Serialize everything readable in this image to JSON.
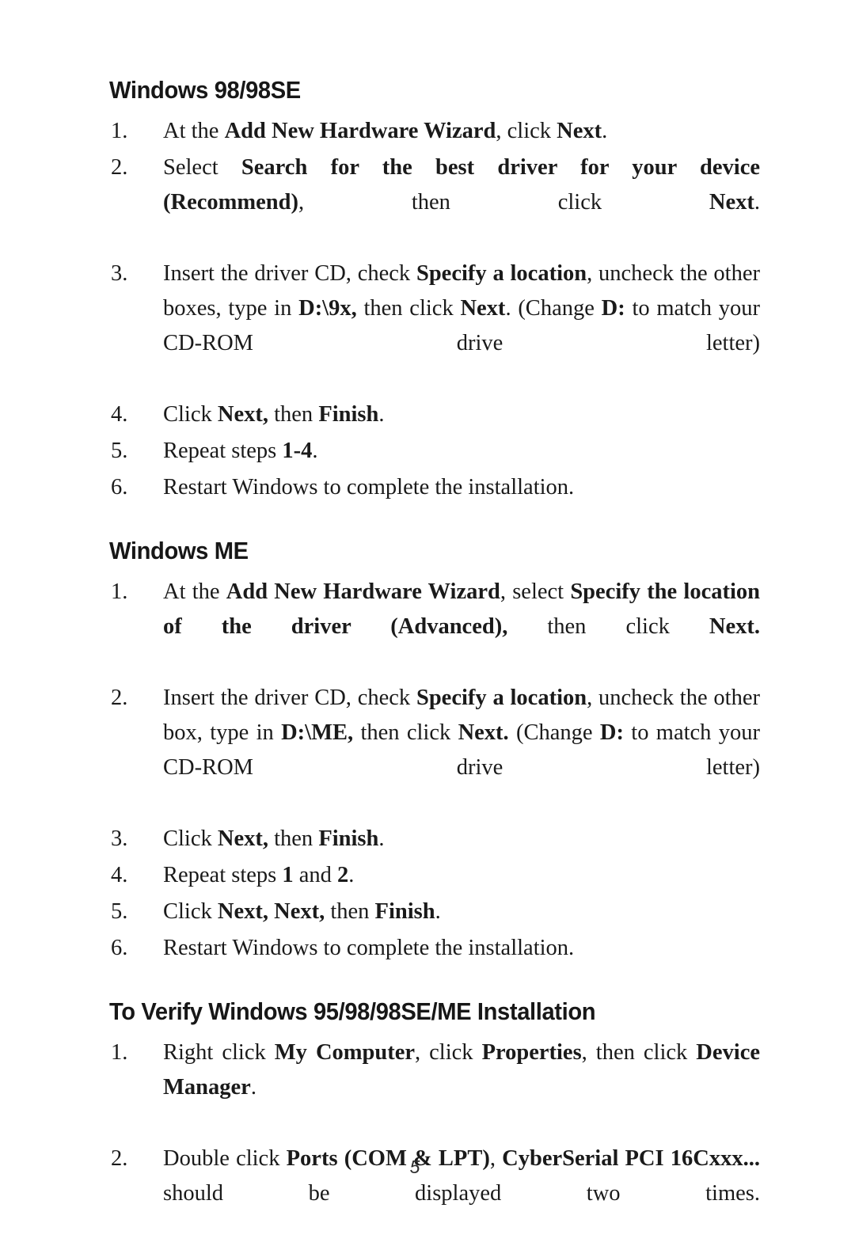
{
  "page": {
    "number": "5"
  },
  "sections": [
    {
      "heading": "Windows 98/98SE",
      "steps": [
        {
          "num": "1.",
          "parts": [
            {
              "t": "At the ",
              "b": false
            },
            {
              "t": "Add New Hardware Wizard",
              "b": true
            },
            {
              "t": ", click ",
              "b": false
            },
            {
              "t": "Next",
              "b": true
            },
            {
              "t": ".",
              "b": false
            }
          ]
        },
        {
          "num": "2.",
          "parts": [
            {
              "t": "Select ",
              "b": false
            },
            {
              "t": "Search for the best driver for your device (Recommend)",
              "b": true
            },
            {
              "t": ", then click ",
              "b": false
            },
            {
              "t": "Next",
              "b": true
            },
            {
              "t": ".",
              "b": false
            }
          ]
        },
        {
          "num": "3.",
          "parts": [
            {
              "t": "Insert the driver CD, check ",
              "b": false
            },
            {
              "t": "Specify a location",
              "b": true
            },
            {
              "t": ", uncheck the other boxes,  type in ",
              "b": false
            },
            {
              "t": "D:\\9x,",
              "b": true
            },
            {
              "t": " then click ",
              "b": false
            },
            {
              "t": "Next",
              "b": true
            },
            {
              "t": ". (Change ",
              "b": false
            },
            {
              "t": "D:",
              "b": true
            },
            {
              "t": " to match your CD-ROM drive letter)",
              "b": false
            }
          ]
        },
        {
          "num": "4.",
          "parts": [
            {
              "t": "Click ",
              "b": false
            },
            {
              "t": "Next,",
              "b": true
            },
            {
              "t": " then ",
              "b": false
            },
            {
              "t": "Finish",
              "b": true
            },
            {
              "t": ".",
              "b": false
            }
          ]
        },
        {
          "num": "5.",
          "parts": [
            {
              "t": "Repeat steps ",
              "b": false
            },
            {
              "t": "1-4",
              "b": true
            },
            {
              "t": ".",
              "b": false
            }
          ]
        },
        {
          "num": "6.",
          "parts": [
            {
              "t": "Restart Windows to complete the installation.",
              "b": false
            }
          ]
        }
      ]
    },
    {
      "heading": "Windows ME",
      "steps": [
        {
          "num": "1.",
          "parts": [
            {
              "t": "At the ",
              "b": false
            },
            {
              "t": "Add New Hardware Wizard",
              "b": true
            },
            {
              "t": ", select ",
              "b": false
            },
            {
              "t": "Specify the location of the driver (Advanced),",
              "b": true
            },
            {
              "t": " then click ",
              "b": false
            },
            {
              "t": "Next.",
              "b": true
            }
          ]
        },
        {
          "num": "2.",
          "parts": [
            {
              "t": "Insert the driver CD, check ",
              "b": false
            },
            {
              "t": "Specify a location",
              "b": true
            },
            {
              "t": ", uncheck the other box, type in ",
              "b": false
            },
            {
              "t": "D:\\ME,",
              "b": true
            },
            {
              "t": " then click ",
              "b": false
            },
            {
              "t": "Next.",
              "b": true
            },
            {
              "t": " (Change ",
              "b": false
            },
            {
              "t": "D:",
              "b": true
            },
            {
              "t": " to match your CD-ROM drive letter)",
              "b": false
            }
          ]
        },
        {
          "num": "3.",
          "parts": [
            {
              "t": "Click ",
              "b": false
            },
            {
              "t": "Next,",
              "b": true
            },
            {
              "t": " then ",
              "b": false
            },
            {
              "t": "Finish",
              "b": true
            },
            {
              "t": ".",
              "b": false
            }
          ]
        },
        {
          "num": "4.",
          "parts": [
            {
              "t": "Repeat steps ",
              "b": false
            },
            {
              "t": "1",
              "b": true
            },
            {
              "t": " and ",
              "b": false
            },
            {
              "t": "2",
              "b": true
            },
            {
              "t": ".",
              "b": false
            }
          ]
        },
        {
          "num": "5.",
          "parts": [
            {
              "t": "Click ",
              "b": false
            },
            {
              "t": "Next,",
              "b": true
            },
            {
              "t": " ",
              "b": false
            },
            {
              "t": "Next,",
              "b": true
            },
            {
              "t": " then ",
              "b": false
            },
            {
              "t": "Finish",
              "b": true
            },
            {
              "t": ".",
              "b": false
            }
          ]
        },
        {
          "num": "6.",
          "parts": [
            {
              "t": "Restart Windows to complete the installation.",
              "b": false
            }
          ]
        }
      ]
    },
    {
      "heading": "To Verify Windows 95/98/98SE/ME Installation",
      "steps": [
        {
          "num": "1.",
          "parts": [
            {
              "t": "Right click ",
              "b": false
            },
            {
              "t": "My Computer",
              "b": true
            },
            {
              "t": ", click ",
              "b": false
            },
            {
              "t": "Properties",
              "b": true
            },
            {
              "t": ", then click ",
              "b": false
            },
            {
              "t": "Device Manager",
              "b": true
            },
            {
              "t": ".",
              "b": false
            }
          ]
        },
        {
          "num": "2.",
          "parts": [
            {
              "t": "Double click ",
              "b": false
            },
            {
              "t": "Ports (COM & LPT)",
              "b": true
            },
            {
              "t": ", ",
              "b": false
            },
            {
              "t": "CyberSerial PCI 16Cxxx...",
              "b": true
            },
            {
              "t": " should be displayed two times.",
              "b": false
            }
          ]
        }
      ]
    }
  ]
}
